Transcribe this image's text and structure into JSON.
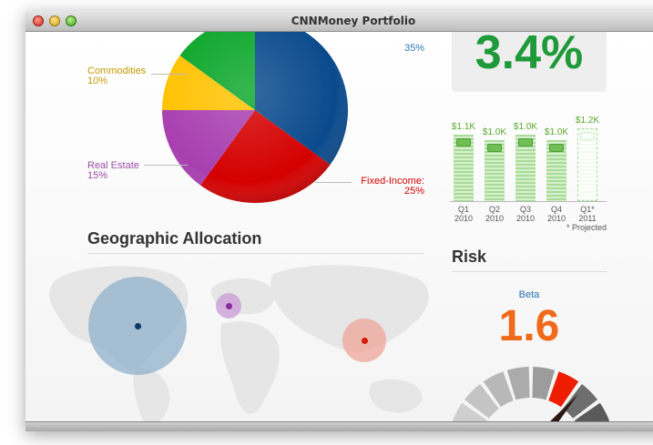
{
  "window": {
    "title": "CNNMoney Portfolio"
  },
  "pie": {
    "labels": {
      "commodities": {
        "name": "Commodities",
        "value": "10%"
      },
      "real_estate": {
        "name": "Real Estate",
        "value": "15%"
      },
      "fixed_income": {
        "name": "Fixed-Income:",
        "value": "25%"
      },
      "top_right_value": "35%"
    },
    "colors": {
      "stocks": "#0a4a8c",
      "fixed_income": "#d40000",
      "real_estate": "#a83fb0",
      "commodities": "#ffc200",
      "cash": "#0aa62a"
    }
  },
  "return_box": {
    "value": "3.4%",
    "color": "#1f9a3a"
  },
  "quarterly_chart": {
    "type": "bar",
    "categories": [
      "Q1 2010",
      "Q2 2010",
      "Q3 2010",
      "Q4 2010",
      "Q1* 2011"
    ],
    "values": [
      1.1,
      1.0,
      1.1,
      1.0,
      1.2
    ],
    "value_labels": [
      "$1.1K",
      "$1.0K",
      "$1.0K",
      "$1.0K",
      "$1.2K"
    ],
    "tick_top": [
      "Q1",
      "Q2",
      "Q3",
      "Q4",
      "Q1*"
    ],
    "tick_bottom": [
      "2010",
      "2010",
      "2010",
      "2010",
      "2011"
    ],
    "projected_note": "* Projected",
    "bar_color": "#a8dc98",
    "projected_index": 4
  },
  "geographic": {
    "heading": "Geographic Allocation",
    "bubbles": [
      {
        "name": "north-america",
        "color": "#8fb0c9",
        "dot": "#0a3a66"
      },
      {
        "name": "europe",
        "color": "#c99bd6",
        "dot": "#8a2aa0"
      },
      {
        "name": "asia",
        "color": "#efa59a",
        "dot": "#d81b00"
      }
    ]
  },
  "risk": {
    "heading": "Risk",
    "beta_label": "Beta",
    "beta_value": "1.6",
    "beta_color": "#f06a1c",
    "beta_label_color": "#2a6fb0"
  }
}
